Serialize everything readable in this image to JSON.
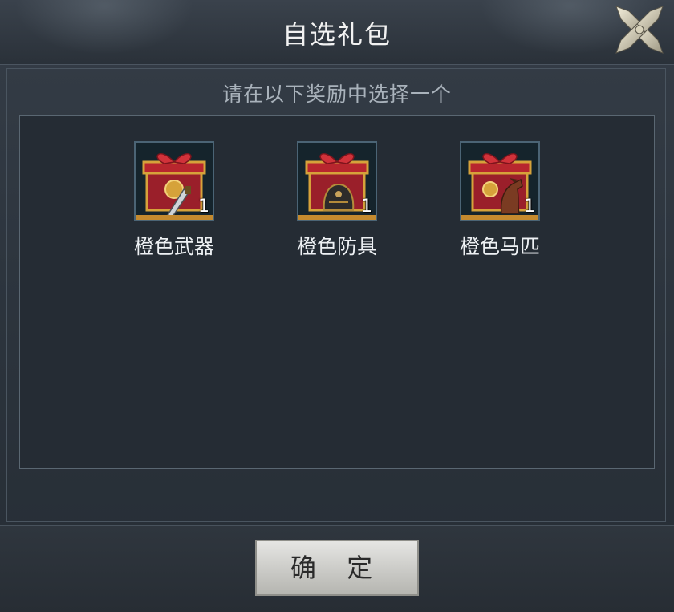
{
  "dialog": {
    "title": "自选礼包",
    "subtitle": "请在以下奖励中选择一个",
    "confirm_label": "确 定"
  },
  "rewards": [
    {
      "name": "橙色武器",
      "quantity": "1",
      "icon": "orange-gift-box-weapon-icon"
    },
    {
      "name": "橙色防具",
      "quantity": "1",
      "icon": "orange-gift-box-armor-icon"
    },
    {
      "name": "橙色马匹",
      "quantity": "1",
      "icon": "orange-gift-box-horse-icon"
    }
  ],
  "colors": {
    "background": "#2b323b",
    "panel": "#252c34",
    "text": "#eef1f4",
    "subtitle": "#a9b2bb",
    "gift_red": "#b8262e",
    "gift_gold": "#d6a23a"
  }
}
